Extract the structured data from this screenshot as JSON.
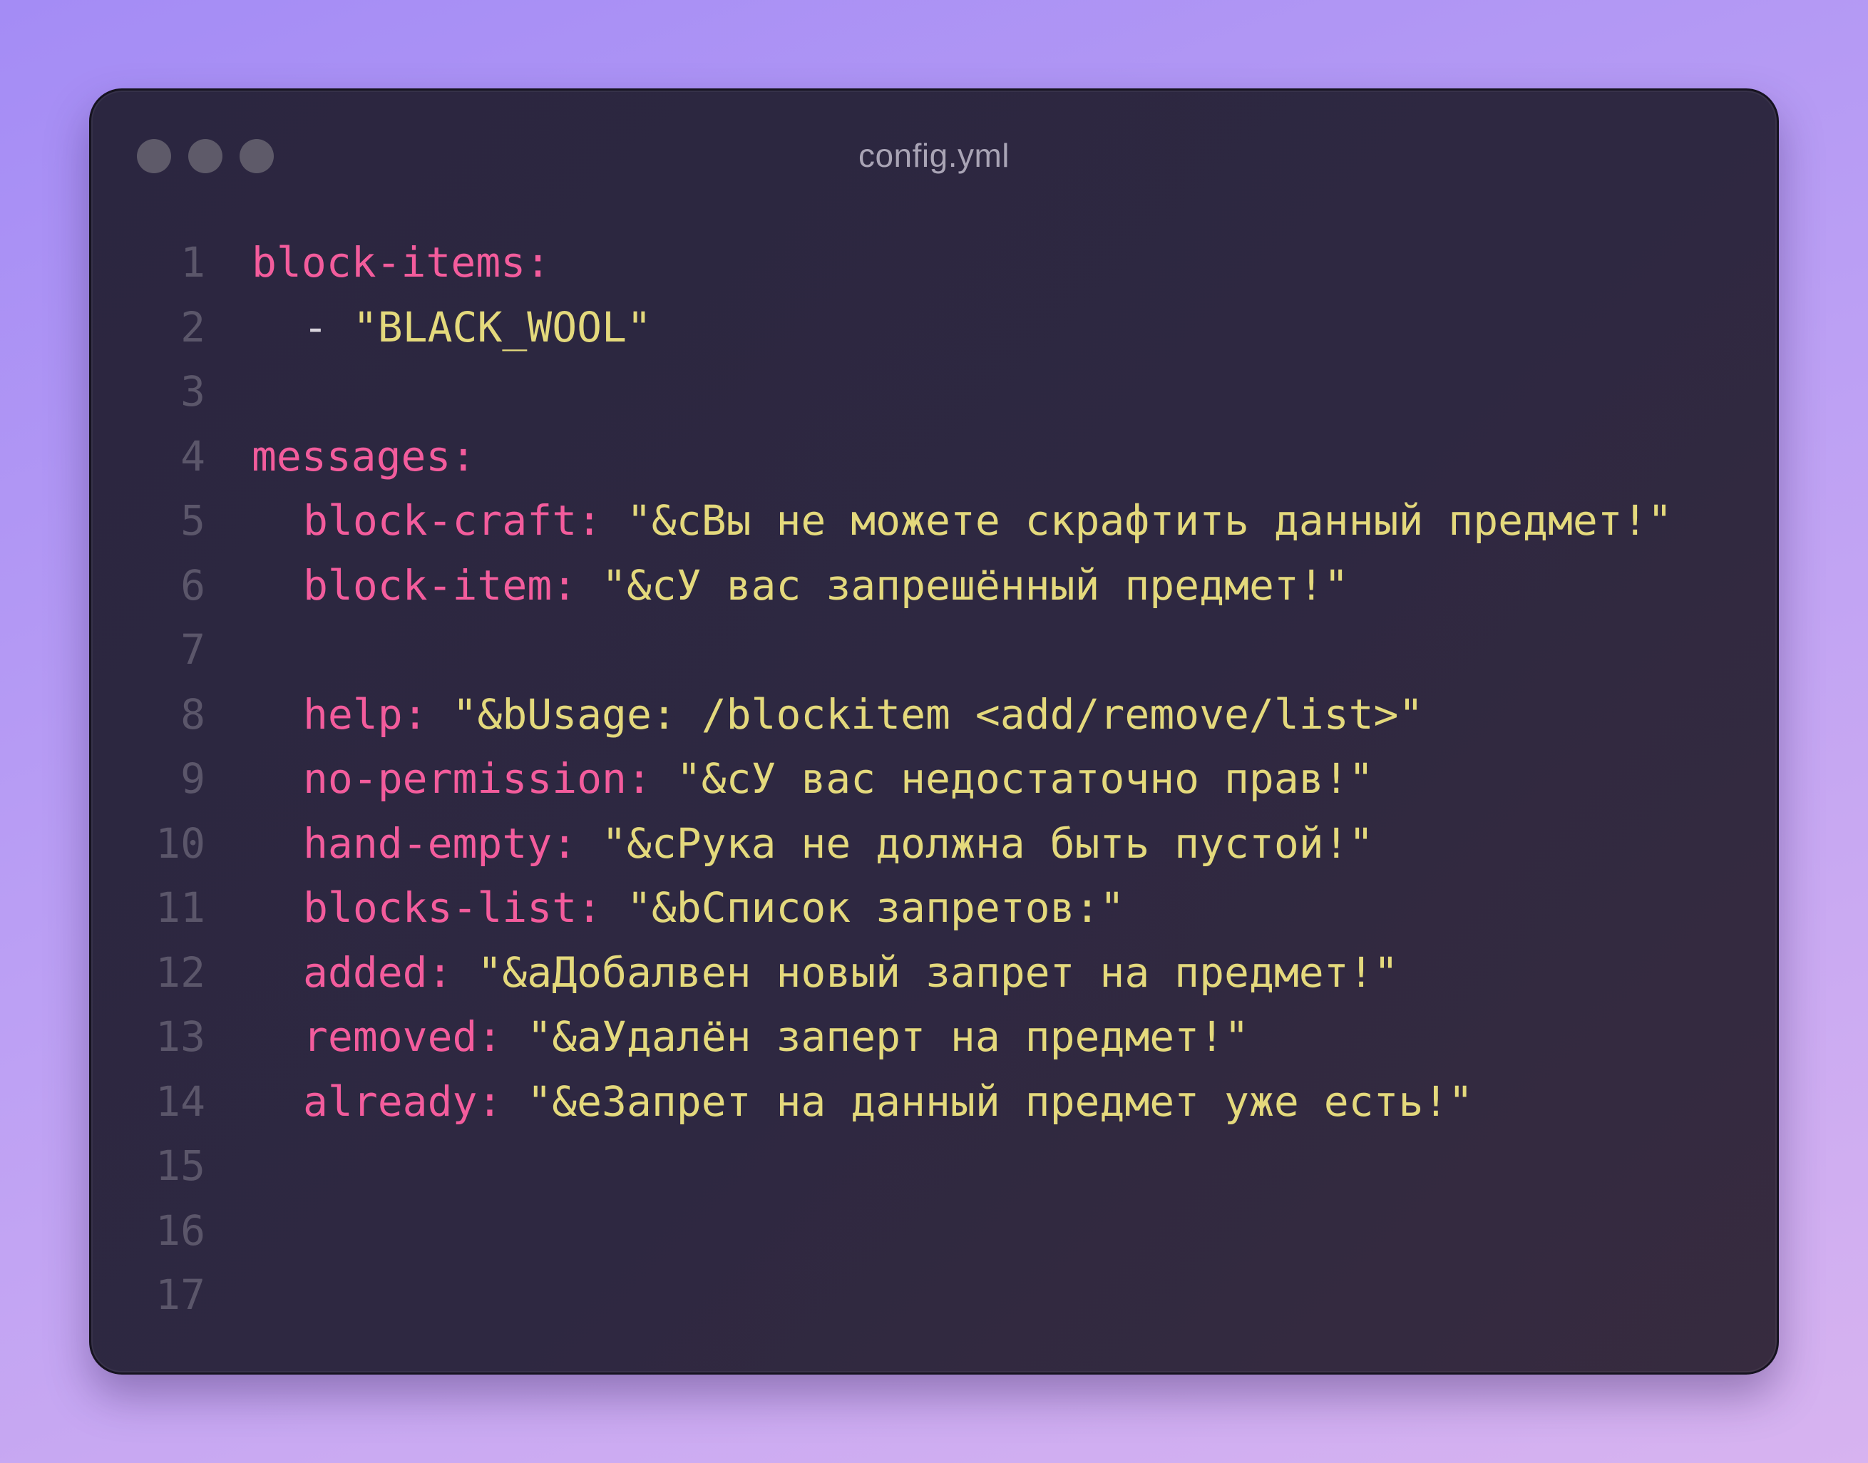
{
  "window": {
    "title": "config.yml",
    "traffic_lights": [
      "close",
      "minimize",
      "maximize"
    ]
  },
  "colors": {
    "key": "#f35c9c",
    "string": "#e4d97c",
    "line_number": "#5b566a",
    "window_background": "#2e2841"
  },
  "lines": [
    {
      "n": "1",
      "indent": 0,
      "key": "block-items",
      "colon": ":",
      "dash": "",
      "value": ""
    },
    {
      "n": "2",
      "indent": 1,
      "key": "",
      "colon": "",
      "dash": "- ",
      "value": "\"BLACK_WOOL\""
    },
    {
      "n": "3",
      "indent": 0,
      "key": "",
      "colon": "",
      "dash": "",
      "value": ""
    },
    {
      "n": "4",
      "indent": 0,
      "key": "messages",
      "colon": ":",
      "dash": "",
      "value": ""
    },
    {
      "n": "5",
      "indent": 1,
      "key": "block-craft",
      "colon": ": ",
      "dash": "",
      "value": "\"&cВы не можете скрафтить данный предмет!\""
    },
    {
      "n": "6",
      "indent": 1,
      "key": "block-item",
      "colon": ": ",
      "dash": "",
      "value": "\"&cУ вас запрешённый предмет!\""
    },
    {
      "n": "7",
      "indent": 0,
      "key": "",
      "colon": "",
      "dash": "",
      "value": ""
    },
    {
      "n": "8",
      "indent": 1,
      "key": "help",
      "colon": ": ",
      "dash": "",
      "value": "\"&bUsage: /blockitem <add/remove/list>\""
    },
    {
      "n": "9",
      "indent": 1,
      "key": "no-permission",
      "colon": ": ",
      "dash": "",
      "value": "\"&cУ вас недостаточно прав!\""
    },
    {
      "n": "10",
      "indent": 1,
      "key": "hand-empty",
      "colon": ": ",
      "dash": "",
      "value": "\"&cРука не должна быть пустой!\""
    },
    {
      "n": "11",
      "indent": 1,
      "key": "blocks-list",
      "colon": ": ",
      "dash": "",
      "value": "\"&bСписок запретов:\""
    },
    {
      "n": "12",
      "indent": 1,
      "key": "added",
      "colon": ": ",
      "dash": "",
      "value": "\"&aДобалвен новый запрет на предмет!\""
    },
    {
      "n": "13",
      "indent": 1,
      "key": "removed",
      "colon": ": ",
      "dash": "",
      "value": "\"&aУдалён заперт на предмет!\""
    },
    {
      "n": "14",
      "indent": 1,
      "key": "already",
      "colon": ": ",
      "dash": "",
      "value": "\"&eЗапрет на данный предмет уже есть!\""
    },
    {
      "n": "15",
      "indent": 0,
      "key": "",
      "colon": "",
      "dash": "",
      "value": ""
    },
    {
      "n": "16",
      "indent": 0,
      "key": "",
      "colon": "",
      "dash": "",
      "value": ""
    },
    {
      "n": "17",
      "indent": 0,
      "key": "",
      "colon": "",
      "dash": "",
      "value": ""
    }
  ]
}
